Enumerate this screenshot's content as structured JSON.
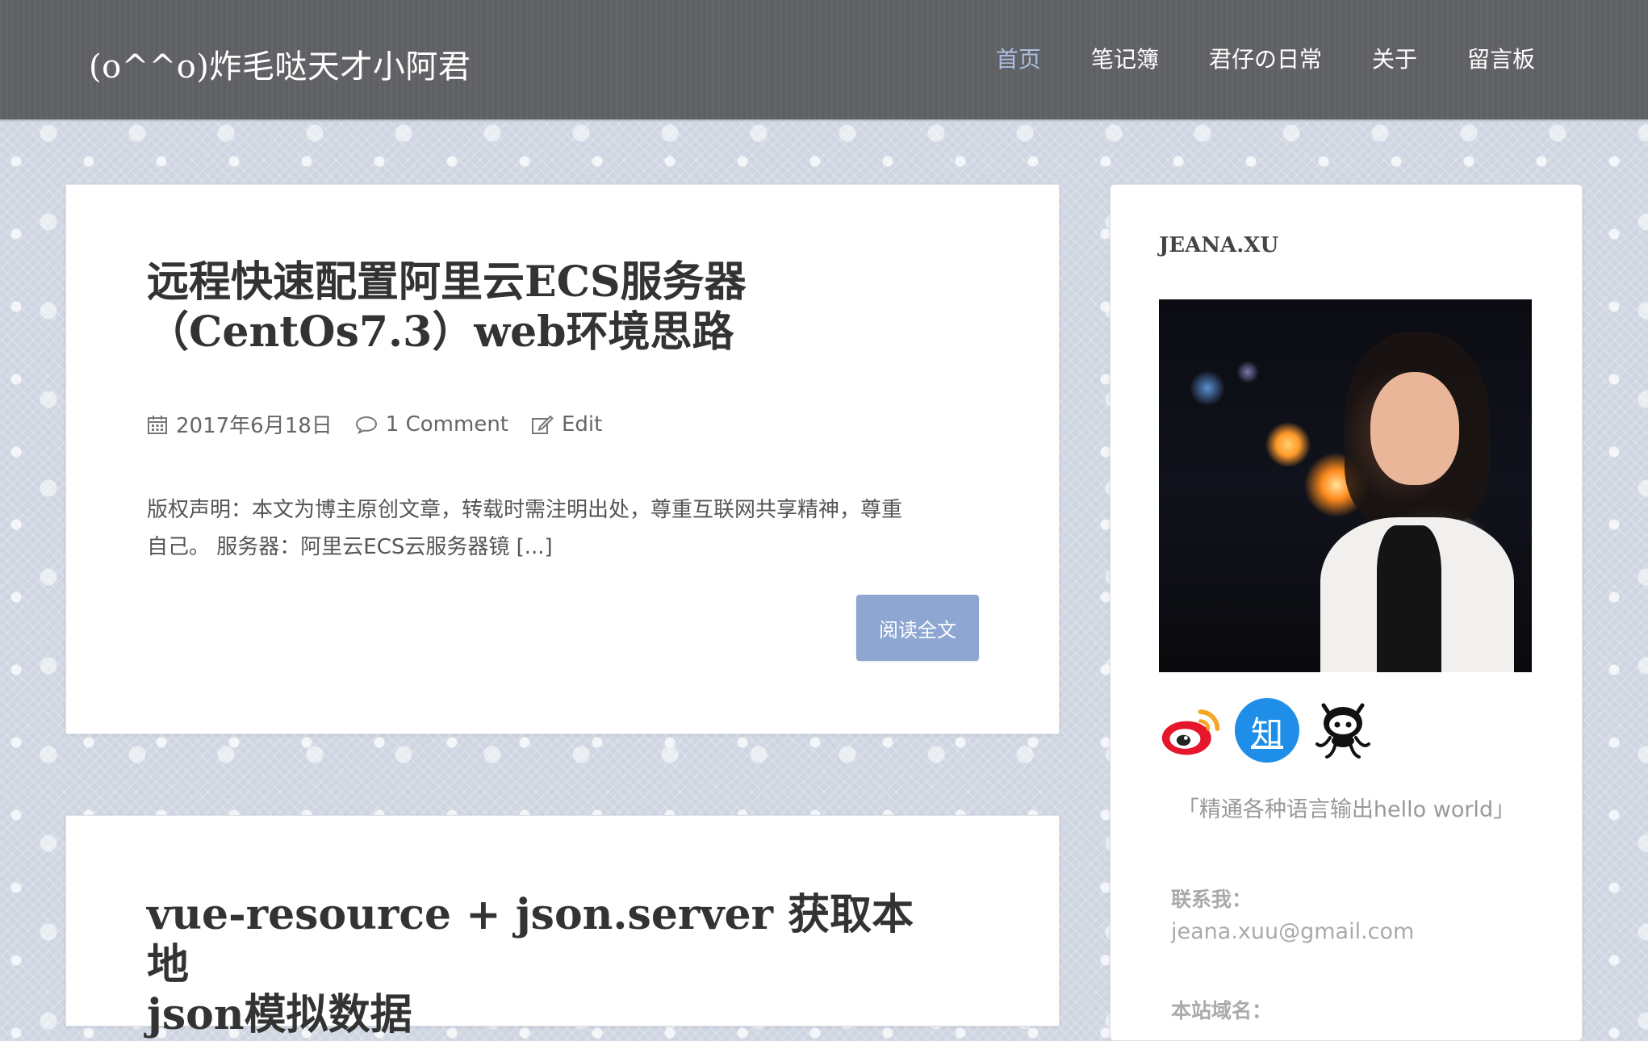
{
  "site": {
    "title": "(o^^o)炸毛哒天才小阿君"
  },
  "nav": {
    "items": [
      {
        "label": "首页",
        "active": true
      },
      {
        "label": "笔记簿",
        "active": false
      },
      {
        "label": "君仔の日常",
        "active": false
      },
      {
        "label": "关于",
        "active": false
      },
      {
        "label": "留言板",
        "active": false
      }
    ],
    "active_color": "#a9bee0"
  },
  "posts": [
    {
      "title_line1": "远程快速配置阿里云ECS服务器",
      "title_line2": "（CentOs7.3）web环境思路",
      "date": "2017年6月18日",
      "comments": "1 Comment",
      "edit": "Edit",
      "excerpt_line1": "版权声明：本文为博主原创文章，转载时需注明出处，尊重互联网共享精神，尊重",
      "excerpt_line2": "自己。 服务器：阿里云ECS云服务器镜 [...]",
      "read_more": "阅读全文",
      "icons": [
        "calendar-icon",
        "comment-icon",
        "edit-icon"
      ]
    },
    {
      "title_line1": "vue-resource + json.server 获取本地",
      "title_line2": "json模拟数据"
    }
  ],
  "sidebar": {
    "author": "JEANA.XU",
    "social": [
      {
        "name": "weibo-icon"
      },
      {
        "name": "zhihu-icon",
        "glyph": "知"
      },
      {
        "name": "github-octocat-icon"
      }
    ],
    "motto": "「精通各种语言输出hello world」",
    "contact_label": "联系我：",
    "contact_email": "jeana.xuu@gmail.com",
    "domain_label": "本站域名："
  },
  "colors": {
    "navbar": "#5f6063",
    "button": "#8ea6d2",
    "zhihu": "#1e8ee8",
    "weibo": "#e6162d"
  }
}
